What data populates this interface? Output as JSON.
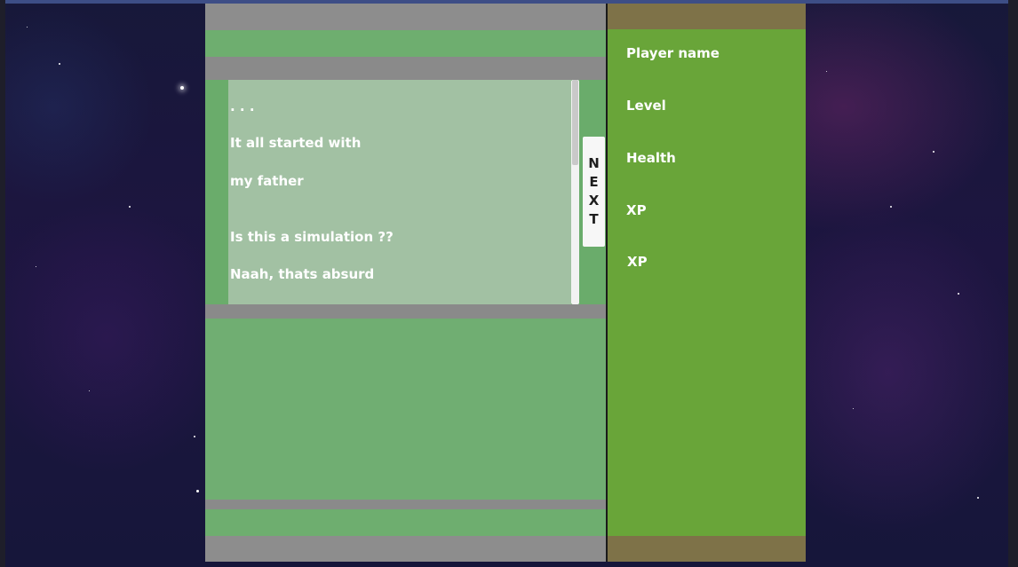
{
  "story": {
    "lines": [
      ". . .",
      "It all started with",
      "my father",
      "Is this a simulation ??",
      "Naah, thats absurd"
    ]
  },
  "buttons": {
    "next_letters": [
      "N",
      "E",
      "X",
      "T"
    ]
  },
  "stats": {
    "player_name_label": "Player name",
    "level_label": "Level",
    "health_label": "Health",
    "xp_label_1": "XP",
    "xp_label_2": "XP"
  },
  "colors": {
    "panel_green": "#69a539",
    "panel_brown": "#7e7248",
    "story_box": "#a2c1a3",
    "band_green": "#6db06e",
    "gray": "#8a8a8a"
  }
}
